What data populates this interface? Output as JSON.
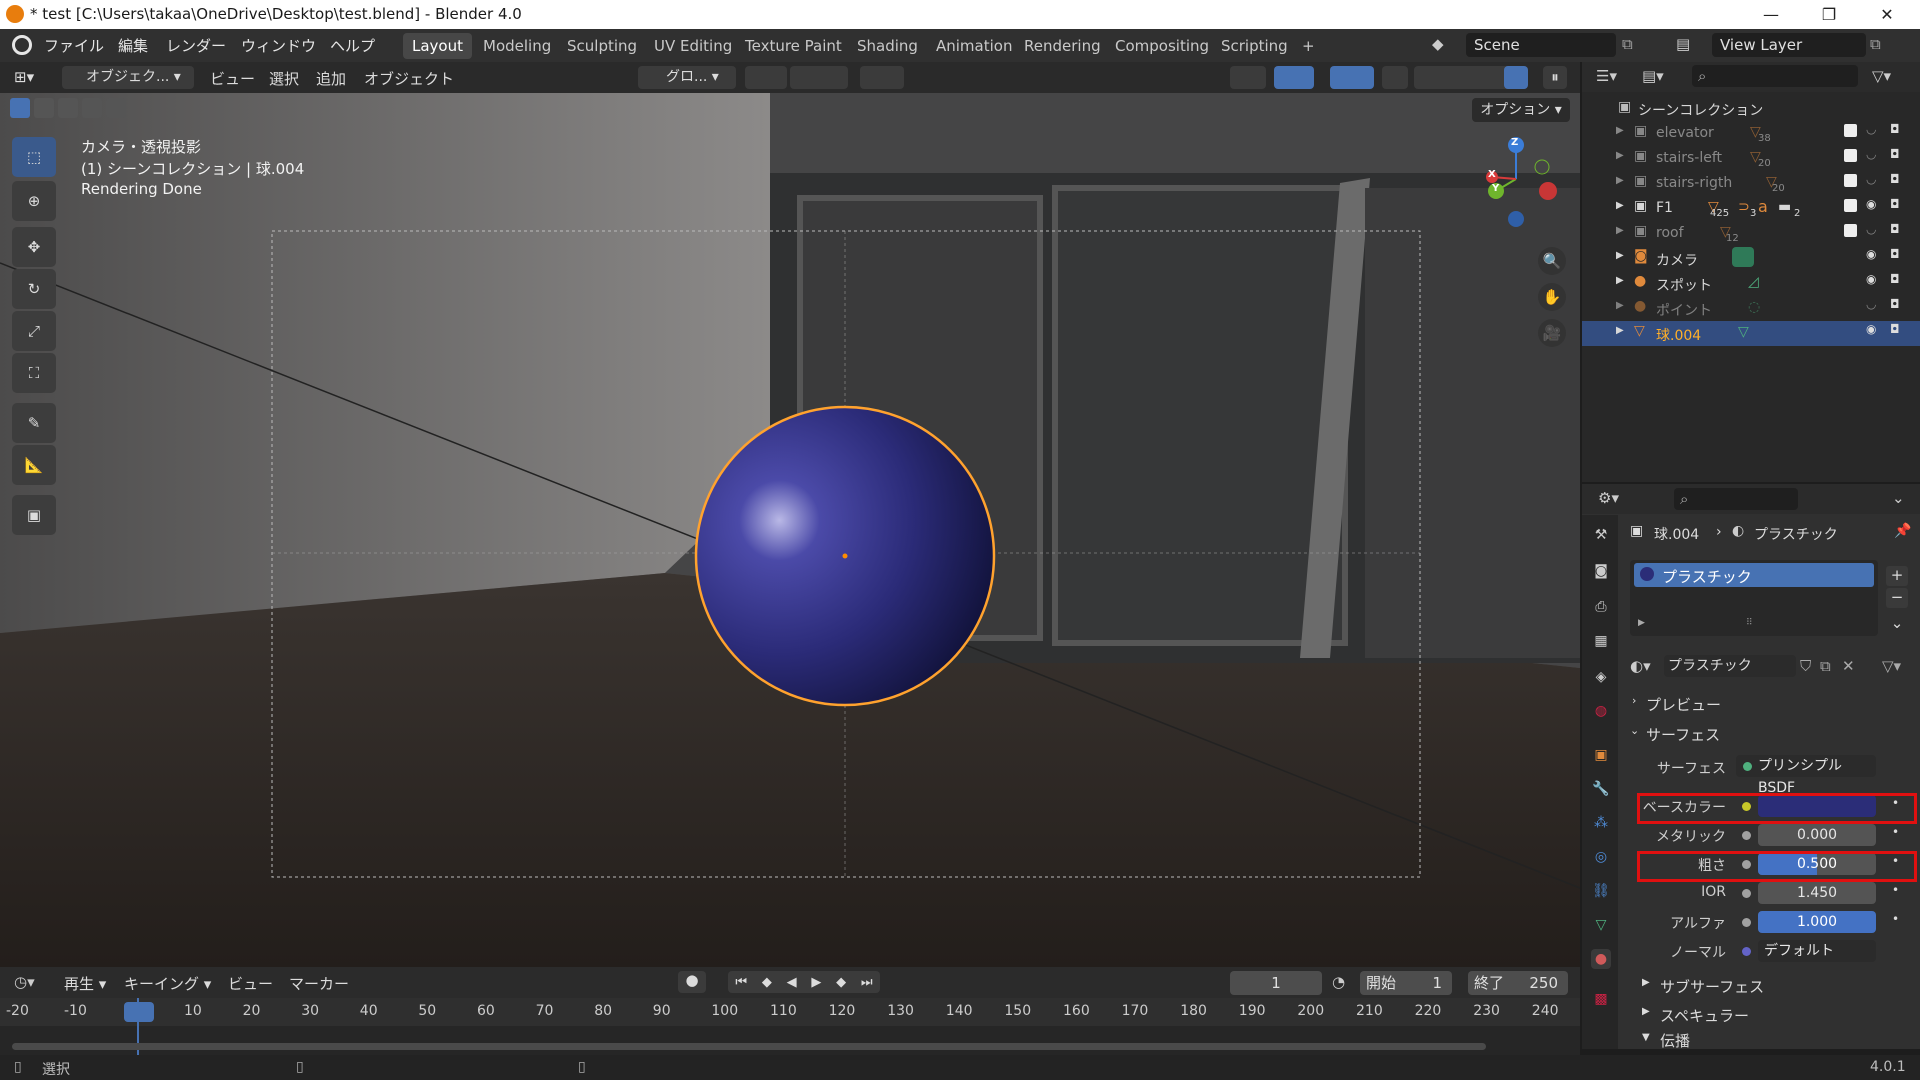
{
  "titlebar": {
    "title": "* test [C:\\Users\\takaa\\OneDrive\\Desktop\\test.blend] - Blender 4.0",
    "minimize": "—",
    "maximize": "❐",
    "close": "✕"
  },
  "menu": [
    "ファイル",
    "編集",
    "レンダー",
    "ウィンドウ",
    "ヘルプ"
  ],
  "workspaces": [
    "Layout",
    "Modeling",
    "Sculpting",
    "UV Editing",
    "Texture Paint",
    "Shading",
    "Animation",
    "Rendering",
    "Compositing",
    "Scripting"
  ],
  "add_workspace": "+",
  "scene": "Scene",
  "view_layer": "View Layer",
  "viewport_header": {
    "mode": "オブジェク...",
    "menus": [
      "ビュー",
      "選択",
      "追加",
      "オブジェクト"
    ],
    "orientation": "グロ...",
    "options": "オプション"
  },
  "viewport_info": {
    "line1": "カメラ・透視投影",
    "line2": "(1) シーンコレクション | 球.004",
    "line3": "Rendering Done"
  },
  "gizmo": {
    "x": "X",
    "y": "Y",
    "z": "Z"
  },
  "outliner": {
    "root": "シーンコレクション",
    "items": [
      {
        "name": "elevator",
        "count": "38"
      },
      {
        "name": "stairs-left",
        "count": "20"
      },
      {
        "name": "stairs-rigth",
        "count": "20"
      },
      {
        "name": "F1",
        "count": "425"
      },
      {
        "name": "roof",
        "count": "12"
      },
      {
        "name": "カメラ",
        "count": ""
      },
      {
        "name": "スポット",
        "count": ""
      },
      {
        "name": "ポイント",
        "count": ""
      },
      {
        "name": "球.004",
        "count": ""
      }
    ],
    "f1_extra": [
      "3",
      "2"
    ]
  },
  "properties": {
    "breadcrumb_object": "球.004",
    "breadcrumb_material": "プラスチック",
    "slot": "プラスチック",
    "material_name": "プラスチック",
    "preview": "プレビュー",
    "surface_panel": "サーフェス",
    "surface_label": "サーフェス",
    "surface_value": "プリンシプルBSDF",
    "base_color_label": "ベースカラー",
    "base_color": "#2b2d78",
    "metallic_label": "メタリック",
    "metallic": "0.000",
    "roughness_label": "粗さ",
    "roughness": "0.500",
    "roughness_fraction": 0.5,
    "ior_label": "IOR",
    "ior": "1.450",
    "alpha_label": "アルファ",
    "alpha": "1.000",
    "normal_label": "ノーマル",
    "normal": "デフォルト",
    "subsurface": "サブサーフェス",
    "specular": "スペキュラー",
    "transmission": "伝播"
  },
  "timeline": {
    "menus": [
      "再生",
      "キーイング",
      "ビュー",
      "マーカー"
    ],
    "current_frame": "1",
    "start_label": "開始",
    "start": "1",
    "end_label": "終了",
    "end": "250",
    "ticks": [
      "-20",
      "-10",
      "1",
      "10",
      "20",
      "30",
      "40",
      "50",
      "60",
      "70",
      "80",
      "90",
      "100",
      "110",
      "120",
      "130",
      "140",
      "150",
      "160",
      "170",
      "180",
      "190",
      "200",
      "210",
      "220",
      "230",
      "240"
    ]
  },
  "status": {
    "select": "選択",
    "version": "4.0.1"
  },
  "colors": {
    "accent": "#4772b3",
    "selection": "#ffa22e",
    "highlight_box": "#e01010"
  }
}
